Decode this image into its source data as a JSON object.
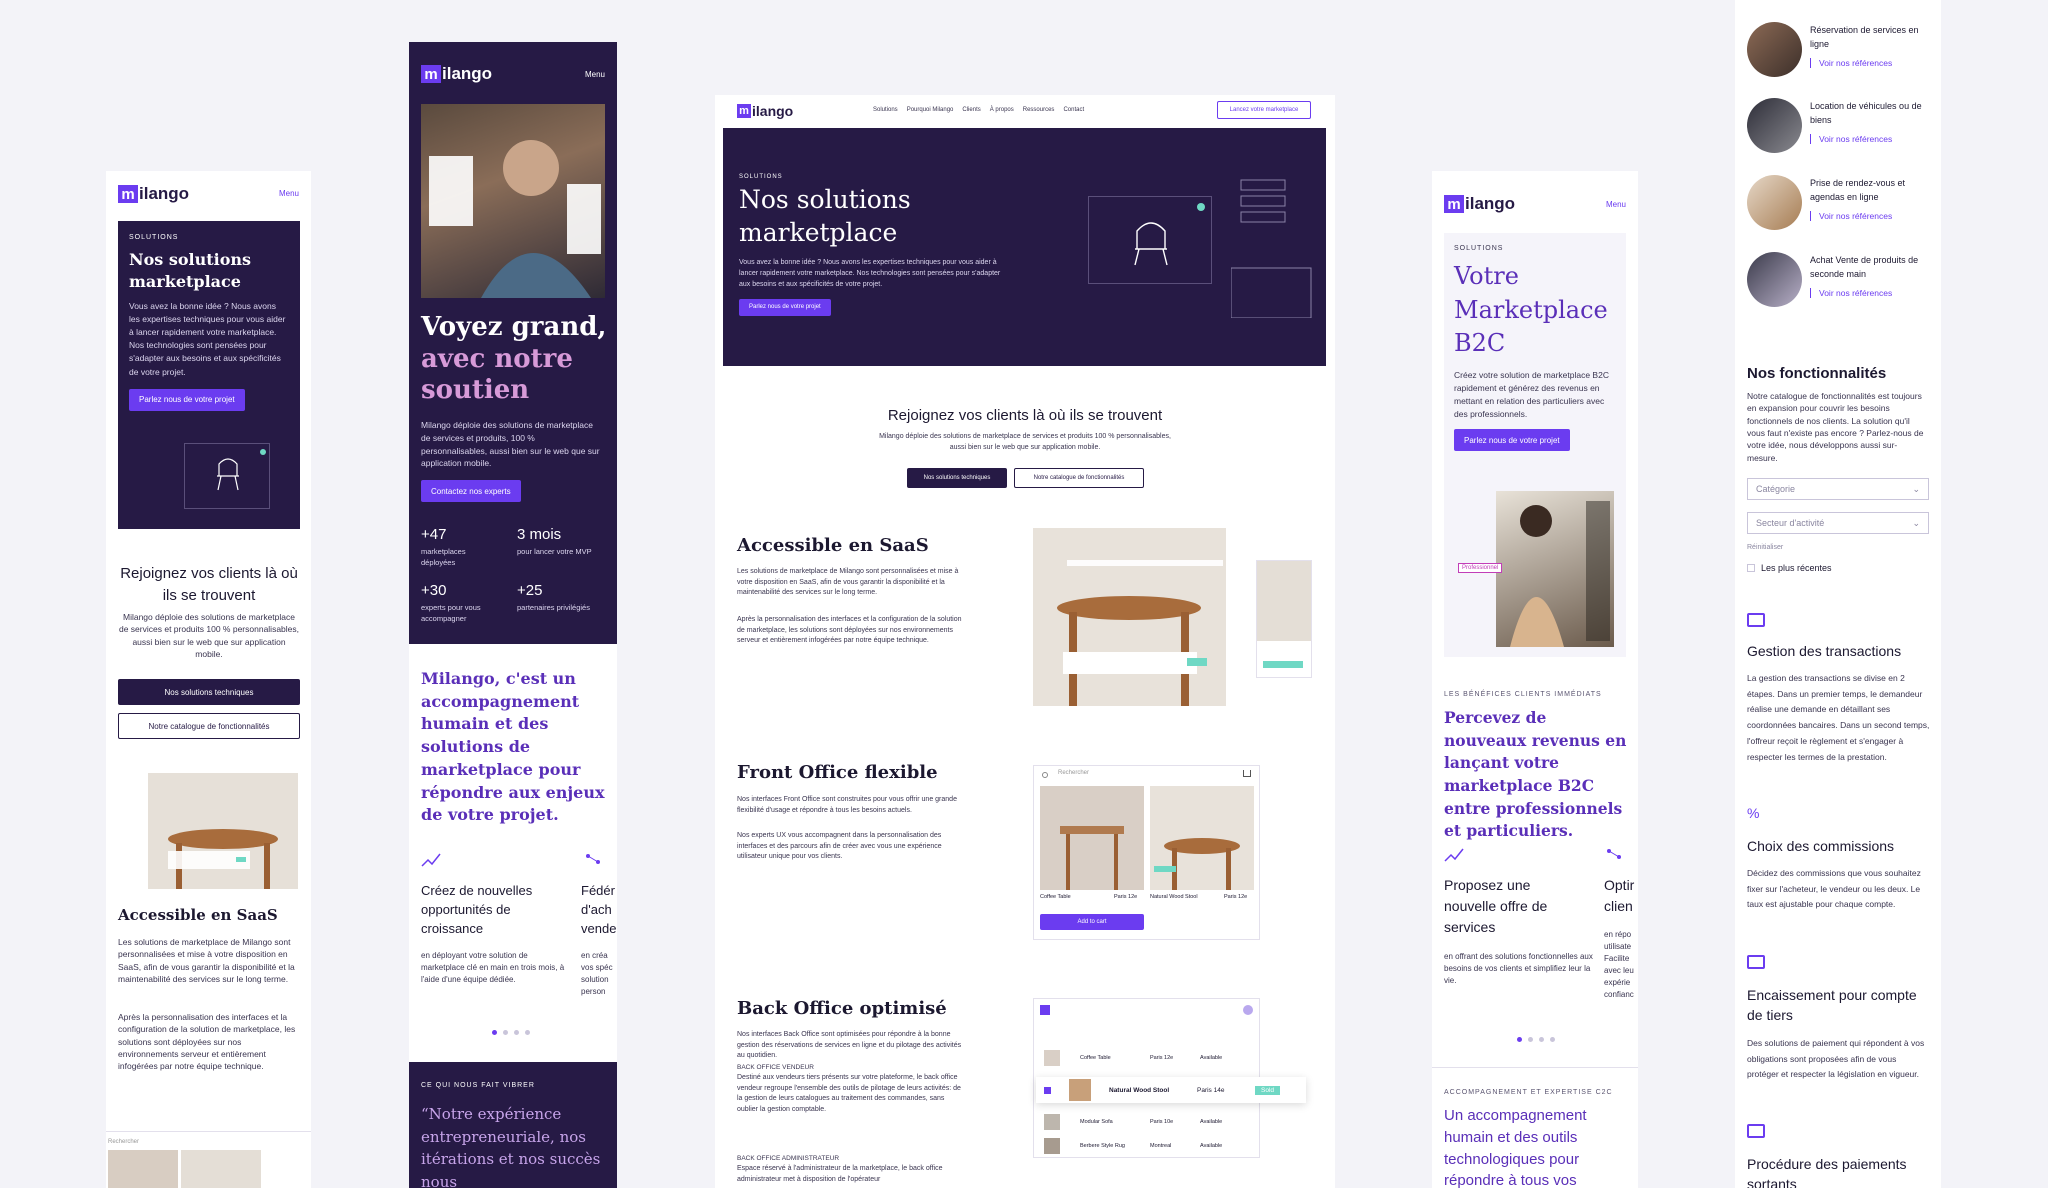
{
  "brand": {
    "logo_text": "ilango",
    "menu": "Menu",
    "accent": "#6b3cf0",
    "dark": "#261a45"
  },
  "m1": {
    "eyebrow": "SOLUTIONS",
    "title": "Nos solutions marketplace",
    "intro": "Vous avez la bonne idée ? Nous avons les expertises techniques pour vous aider à lancer rapidement votre marketplace. Nos technologies sont pensées pour s'adapter aux besoins et aux spécificités de votre projet.",
    "cta": "Parlez nous de votre projet",
    "join_title": "Rejoignez vos clients là où ils se trouvent",
    "join_text": "Milango déploie des solutions de marketplace de services et produits 100 % personnalisables, aussi bien sur le web que sur application mobile.",
    "btn1": "Nos solutions techniques",
    "btn2": "Notre catalogue de fonctionnalités",
    "saas_title": "Accessible en SaaS",
    "saas_p1": "Les solutions de marketplace de Milango sont personnalisées et mise à votre disposition en SaaS, afin de vous garantir la disponibilité et la maintenabilité des services sur le long terme.",
    "saas_p2": "Après la personnalisation des interfaces et la configuration de la solution de marketplace, les solutions sont déployées sur nos environnements serveur et entièrement infogérées par notre équipe technique.",
    "search": "Rechercher",
    "product": "Natural Wood Stool"
  },
  "m2": {
    "title_a": "Voyez grand,",
    "title_b": "avec notre soutien",
    "text": "Milango déploie des solutions de marketplace de services et produits, 100 % personnalisables, aussi bien sur le web que sur application mobile.",
    "cta": "Contactez nos experts",
    "stats": [
      {
        "value": "+47",
        "label": "marketplaces déployées"
      },
      {
        "value": "3 mois",
        "label": "pour lancer votre MVP"
      },
      {
        "value": "+30",
        "label": "experts pour vous accompagner"
      },
      {
        "value": "+25",
        "label": "partenaires privilégiés"
      }
    ],
    "quote_title": "Milango, c'est un accompagnement humain et des solutions de marketplace pour répondre aux enjeux de votre projet.",
    "card1_title": "Créez de nouvelles opportunités de croissance",
    "card1_text": "en déployant votre solution de marketplace clé en main en trois mois, à l'aide d'une équipe dédiée.",
    "card2_title": "Fédér d'ach vende",
    "card2_text": "en créa vos spéc solution person",
    "vibe_label": "CE QUI NOUS FAIT VIBRER",
    "vibe_quote": "“Notre expérience entrepreneuriale, nos itérations et nos succès nous"
  },
  "desk": {
    "nav": [
      "Solutions",
      "Pourquoi Milango",
      "Clients",
      "À propos",
      "Ressources",
      "Contact"
    ],
    "nav_cta": "Lancez votre marketplace",
    "eyebrow": "SOLUTIONS",
    "title": "Nos solutions marketplace",
    "intro": "Vous avez la bonne idée ? Nous avons les expertises techniques pour vous aider à lancer rapidement votre marketplace. Nos technologies sont pensées pour s'adapter aux besoins et aux spécificités de votre projet.",
    "cta": "Parlez nous de votre projet",
    "join_title": "Rejoignez vos clients là où ils se trouvent",
    "join_text": "Milango déploie des solutions de marketplace de services et produits 100 % personnalisables, aussi bien sur le web que sur application mobile.",
    "btn1": "Nos solutions techniques",
    "btn2": "Notre catalogue de fonctionnalités",
    "saas_title": "Accessible en SaaS",
    "saas_p1": "Les solutions de marketplace de Milango sont personnalisées et mise à votre disposition en SaaS, afin de vous garantir la disponibilité et la maintenabilité des services sur le long terme.",
    "saas_p2": "Après la personnalisation des interfaces et la configuration de la solution de marketplace, les solutions sont déployées sur nos environnements serveur et entièrement infogérées par notre équipe technique.",
    "front_title": "Front Office flexible",
    "front_p1": "Nos interfaces Front Office sont construites pour vous offrir une grande flexibilité d'usage et répondre à tous les besoins actuels.",
    "front_p2": "Nos experts UX vous accompagnent dans la personnalisation des interfaces et des parcours afin de créer avec vous une expérience utilisateur unique pour vos clients.",
    "back_title": "Back Office optimisé",
    "back_p1": "Nos interfaces Back Office sont optimisées pour répondre à la bonne gestion des réservations de services en ligne et du pilotage des activités au quotidien.",
    "back_sub1": "BACK OFFICE VENDEUR",
    "back_p2": "Destiné aux vendeurs tiers présents sur votre plateforme, le back office vendeur regroupe l'ensemble des outils de pilotage de leurs activités: de la gestion de leurs catalogues au traitement des commandes, sans oublier la gestion comptable.",
    "back_sub2": "BACK OFFICE ADMINISTRATEUR",
    "back_p3": "Espace réservé à l'administrateur de la marketplace, le back office administrateur met à disposition de l'opérateur",
    "search": "Rechercher",
    "add_cart": "Add to cart",
    "products": [
      {
        "name": "Coffee Table",
        "city": "Paris 12e"
      },
      {
        "name": "Natural Wood Stool",
        "city": "Paris 12e"
      }
    ],
    "table_rows": [
      {
        "name": "Coffee Table",
        "city": "Paris 12e",
        "status": "Available"
      },
      {
        "name": "Natural Wood Stool",
        "city": "Paris 14e",
        "status": "Sold"
      },
      {
        "name": "Modular Sofa",
        "city": "Paris 10e",
        "status": "Available"
      },
      {
        "name": "Berbere Style Rug",
        "city": "Montreal",
        "status": "Available"
      }
    ]
  },
  "m3": {
    "eyebrow": "SOLUTIONS",
    "title": "Votre Marketplace B2C",
    "intro": "Créez votre solution de marketplace B2C rapidement et générez des revenus en mettant en relation des particuliers avec des professionnels.",
    "cta": "Parlez nous de votre projet",
    "tag": "Professionnel",
    "benefits_label": "LES BÉNÉFICES CLIENTS IMMÉDIATS",
    "benefits_title": "Percevez de nouveaux revenus en lançant votre marketplace B2C entre professionnels et particuliers.",
    "card1_title": "Proposez une nouvelle offre de services",
    "card1_text": "en offrant des solutions fonctionnelles aux besoins de vos clients et simplifiez leur la vie.",
    "card2_title": "Optir clien",
    "card2_text": "en répo utilisate Facilite avec leu expérie confianc",
    "c2c_label": "ACCOMPAGNEMENT ET EXPERTISE C2C",
    "c2c_title": "Un accompagnement humain et des outils technologiques pour répondre à tous vos"
  },
  "right": {
    "refs": [
      {
        "title": "Réservation de services en ligne",
        "link": "Voir nos références"
      },
      {
        "title": "Location de véhicules ou de biens",
        "link": "Voir nos références"
      },
      {
        "title": "Prise de rendez-vous et agendas en ligne",
        "link": "Voir nos références"
      },
      {
        "title": "Achat Vente de produits de seconde main",
        "link": "Voir nos références"
      }
    ],
    "features_title": "Nos fonctionnalités",
    "features_text": "Notre catalogue de fonctionnalités est toujours en expansion pour couvrir les besoins fonctionnels de nos clients. La solution qu'il vous faut n'existe pas encore ? Parlez-nous de votre idée, nous développons aussi sur-mesure.",
    "filter1": "Catégorie",
    "filter2": "Secteur d'activité",
    "reset": "Réinitialiser",
    "recent": "Les plus récentes",
    "features": [
      {
        "title": "Gestion des transactions",
        "text": "La gestion des transactions se divise en 2 étapes. Dans un premier temps, le demandeur réalise une demande en détaillant ses coordonnées bancaires. Dans un second temps, l'offreur reçoit le règlement et s'engager à respecter les termes de la prestation."
      },
      {
        "title": "Choix des commissions",
        "text": "Décidez des commissions que vous souhaitez fixer sur l'acheteur, le vendeur ou les deux. Le taux est ajustable pour chaque compte."
      },
      {
        "title": "Encaissement pour compte de tiers",
        "text": "Des solutions de paiement qui répondent à vos obligations sont proposées afin de vous protéger et respecter la législation en vigueur."
      },
      {
        "title": "Procédure des paiements sortants",
        "text": ""
      }
    ]
  }
}
